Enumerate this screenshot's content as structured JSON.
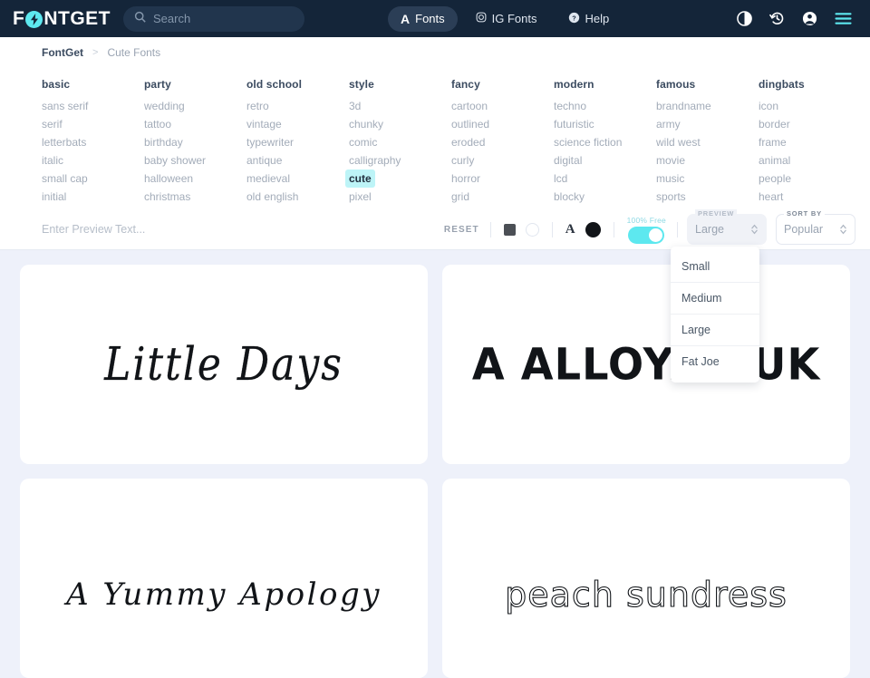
{
  "header": {
    "logo_text_1": "F",
    "logo_text_2": "NTGET",
    "logo_icon": "bolt-circle-icon",
    "search": {
      "placeholder": "Search",
      "value": "",
      "icon": "search-icon"
    },
    "nav": [
      {
        "label": "Fonts",
        "glyph": "A",
        "icon": "letter-a-icon",
        "active": true
      },
      {
        "label": "IG Fonts",
        "glyph": "◎",
        "icon": "instagram-icon",
        "active": false
      },
      {
        "label": "Help",
        "glyph": "?",
        "icon": "help-circle-icon",
        "active": false
      }
    ],
    "icons": [
      {
        "name": "contrast-icon",
        "glyph": "◐"
      },
      {
        "name": "history-icon",
        "glyph": "↺"
      },
      {
        "name": "account-icon",
        "glyph": "●"
      },
      {
        "name": "menu-icon",
        "glyph": "☰"
      }
    ],
    "accent_color": "#5de8ef",
    "background_color": "#142539"
  },
  "breadcrumb": {
    "root": "FontGet",
    "separator": ">",
    "current": "Cute Fonts"
  },
  "categories": [
    {
      "head": "basic",
      "items": [
        "sans serif",
        "serif",
        "letterbats",
        "italic",
        "small cap",
        "initial"
      ]
    },
    {
      "head": "party",
      "items": [
        "wedding",
        "tattoo",
        "birthday",
        "baby shower",
        "halloween",
        "christmas"
      ]
    },
    {
      "head": "old school",
      "items": [
        "retro",
        "vintage",
        "typewriter",
        "antique",
        "medieval",
        "old english"
      ]
    },
    {
      "head": "style",
      "items": [
        "3d",
        "chunky",
        "comic",
        "calligraphy",
        "cute",
        "pixel"
      ],
      "selected": "cute"
    },
    {
      "head": "fancy",
      "items": [
        "cartoon",
        "outlined",
        "eroded",
        "curly",
        "horror",
        "grid"
      ]
    },
    {
      "head": "modern",
      "items": [
        "techno",
        "futuristic",
        "science fiction",
        "digital",
        "lcd",
        "blocky"
      ]
    },
    {
      "head": "famous",
      "items": [
        "brandname",
        "army",
        "wild west",
        "movie",
        "music",
        "sports"
      ]
    },
    {
      "head": "dingbats",
      "items": [
        "icon",
        "border",
        "frame",
        "animal",
        "people",
        "heart"
      ]
    }
  ],
  "toolbar": {
    "preview_placeholder": "Enter Preview Text...",
    "preview_value": "",
    "reset_label": "RESET",
    "bg_swatch_color": "#4b4f55",
    "bg_swatch_empty_color": "#ffffff",
    "text_letter": "A",
    "text_color": "#111418",
    "free_label": "100% Free",
    "free_toggle_on": true,
    "preview_select": {
      "legend": "PREVIEW",
      "value": "Large",
      "open": true
    },
    "sort_select": {
      "legend": "SORT BY",
      "value": "Popular",
      "open": false
    }
  },
  "dropdown": {
    "options": [
      "Small",
      "Medium",
      "Large",
      "Fat Joe"
    ]
  },
  "cards": [
    {
      "text": "Little Days",
      "style": "s-script"
    },
    {
      "text": "A ALLOYA BUK",
      "style": "s-bubble"
    },
    {
      "text": "A Yummy Apology",
      "style": "s-curly"
    },
    {
      "text": "peach sundress",
      "style": "s-outline"
    }
  ]
}
